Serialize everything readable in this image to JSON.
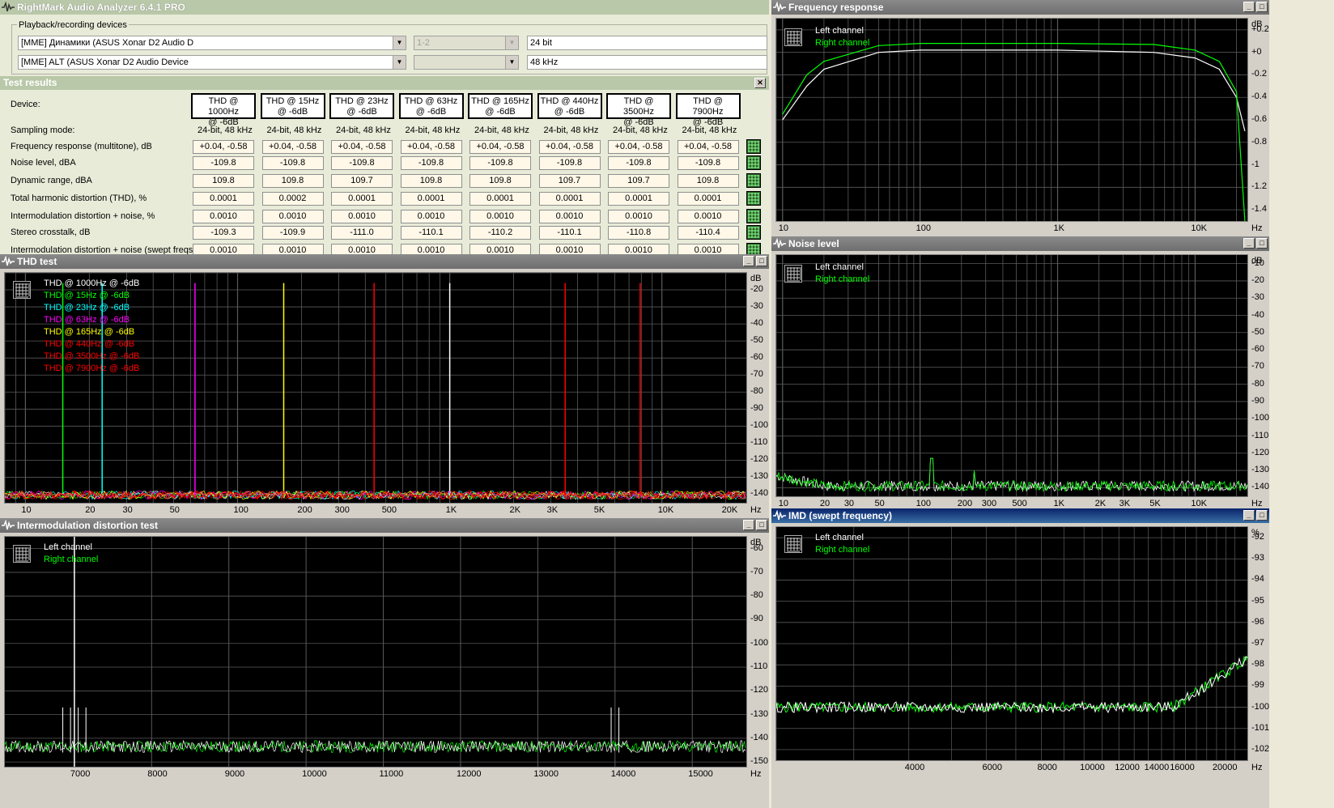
{
  "app": {
    "title": "RightMark Audio Analyzer 6.4.1 PRO",
    "devices_group": "Playback/recording devices",
    "playback_device": "[MME] Динамики (ASUS Xonar D2 Audio D",
    "recording_device": "[MME] ALT (ASUS Xonar D2 Audio Device",
    "channels": "1-2",
    "bits": "24 bit",
    "rate": "48 kHz"
  },
  "results": {
    "title": "Test results",
    "close": "✕",
    "row_labels": [
      "Device:",
      "Sampling mode:",
      "Frequency response (multitone), dB",
      "Noise level, dBA",
      "Dynamic range, dBA",
      "Total harmonic distortion (THD), %",
      "Intermodulation distortion + noise, %",
      "Stereo crosstalk, dB",
      "Intermodulation distortion + noise (swept freqs), %"
    ],
    "columns": [
      {
        "head1": "THD @ 1000Hz",
        "head2": "@ -6dB",
        "mode": "24-bit, 48 kHz",
        "fr": "+0.04, -0.58",
        "noise": "-109.8",
        "dr": "109.8",
        "thd": "0.0001",
        "imd": "0.0010",
        "xtalk": "-109.3",
        "imds": "0.0010"
      },
      {
        "head1": "THD @ 15Hz",
        "head2": "@ -6dB",
        "mode": "24-bit, 48 kHz",
        "fr": "+0.04, -0.58",
        "noise": "-109.8",
        "dr": "109.8",
        "thd": "0.0002",
        "imd": "0.0010",
        "xtalk": "-109.9",
        "imds": "0.0010"
      },
      {
        "head1": "THD @ 23Hz",
        "head2": "@ -6dB",
        "mode": "24-bit, 48 kHz",
        "fr": "+0.04, -0.58",
        "noise": "-109.8",
        "dr": "109.7",
        "thd": "0.0001",
        "imd": "0.0010",
        "xtalk": "-111.0",
        "imds": "0.0010"
      },
      {
        "head1": "THD @ 63Hz",
        "head2": "@ -6dB",
        "mode": "24-bit, 48 kHz",
        "fr": "+0.04, -0.58",
        "noise": "-109.8",
        "dr": "109.8",
        "thd": "0.0001",
        "imd": "0.0010",
        "xtalk": "-110.1",
        "imds": "0.0010"
      },
      {
        "head1": "THD @ 165Hz",
        "head2": "@ -6dB",
        "mode": "24-bit, 48 kHz",
        "fr": "+0.04, -0.58",
        "noise": "-109.8",
        "dr": "109.8",
        "thd": "0.0001",
        "imd": "0.0010",
        "xtalk": "-110.2",
        "imds": "0.0010"
      },
      {
        "head1": "THD @ 440Hz",
        "head2": "@ -6dB",
        "mode": "24-bit, 48 kHz",
        "fr": "+0.04, -0.58",
        "noise": "-109.8",
        "dr": "109.7",
        "thd": "0.0001",
        "imd": "0.0010",
        "xtalk": "-110.1",
        "imds": "0.0010"
      },
      {
        "head1": "THD @ 3500Hz",
        "head2": "@ -6dB",
        "mode": "24-bit, 48 kHz",
        "fr": "+0.04, -0.58",
        "noise": "-109.8",
        "dr": "109.7",
        "thd": "0.0001",
        "imd": "0.0010",
        "xtalk": "-110.8",
        "imds": "0.0010"
      },
      {
        "head1": "THD @ 7900Hz",
        "head2": "@ -6dB",
        "mode": "24-bit, 48 kHz",
        "fr": "+0.04, -0.58",
        "noise": "-109.8",
        "dr": "109.8",
        "thd": "0.0001",
        "imd": "0.0010",
        "xtalk": "-110.4",
        "imds": "0.0010"
      }
    ]
  },
  "panels": {
    "freq": {
      "title": "Frequency response",
      "legend": [
        "Left channel",
        "Right channel"
      ],
      "unit_y": "dB",
      "unit_x": "Hz"
    },
    "noise": {
      "title": "Noise level",
      "legend": [
        "Left channel",
        "Right channel"
      ],
      "unit_y": "dB",
      "unit_x": "Hz"
    },
    "thd": {
      "title": "THD test",
      "legend": [
        "THD @ 1000Hz  @ -6dB",
        "THD @ 15Hz  @ -6dB",
        "THD @ 23Hz  @ -6dB",
        "THD @ 63Hz  @ -6dB",
        "THD @ 165Hz  @ -6dB",
        "THD @ 440Hz  @ -6dB",
        "THD @ 3500Hz  @ -6dB",
        "THD @ 7900Hz  @ -6dB"
      ],
      "unit_y": "dB",
      "unit_x": "Hz"
    },
    "imd": {
      "title": "Intermodulation distortion test",
      "legend": [
        "Left channel",
        "Right channel"
      ],
      "unit_y": "dB",
      "unit_x": "Hz"
    },
    "imds": {
      "title": "IMD (swept frequency)",
      "legend": [
        "Left channel",
        "Right channel"
      ],
      "unit_y": "%",
      "unit_x": "Hz"
    }
  },
  "colors": {
    "left": "#ffffff",
    "right": "#00ff00",
    "thd": [
      "#ffffff",
      "#00ff00",
      "#00ffff",
      "#ff00ff",
      "#ffff00",
      "#ff0000",
      "#ff0000",
      "#ff0000"
    ]
  },
  "chart_data": [
    {
      "type": "line",
      "id": "freq",
      "x_ticks": [
        "10",
        "100",
        "1K",
        "10K"
      ],
      "y_ticks": [
        "+0.2",
        "+0",
        "-0.2",
        "-0.4",
        "-0.6",
        "-0.8",
        "-1",
        "-1.2",
        "-1.4"
      ],
      "ylim": [
        -1.5,
        0.3
      ],
      "series": [
        {
          "name": "Left channel",
          "x": [
            10,
            15,
            20,
            50,
            100,
            1000,
            5000,
            10000,
            15000,
            20000,
            23000
          ],
          "y": [
            -0.6,
            -0.3,
            -0.15,
            0.0,
            0.02,
            0.02,
            0.0,
            -0.05,
            -0.15,
            -0.4,
            -0.7
          ]
        },
        {
          "name": "Right channel",
          "x": [
            10,
            15,
            20,
            50,
            100,
            1000,
            5000,
            10000,
            15000,
            20000,
            23000
          ],
          "y": [
            -0.55,
            -0.2,
            -0.08,
            0.06,
            0.08,
            0.08,
            0.07,
            0.02,
            -0.08,
            -0.35,
            -1.5
          ]
        }
      ]
    },
    {
      "type": "line",
      "id": "noise",
      "x_ticks": [
        "10",
        "20",
        "30",
        "50",
        "100",
        "200",
        "300",
        "500",
        "1K",
        "2K",
        "3K",
        "5K",
        "10K"
      ],
      "y_ticks": [
        "-10",
        "-20",
        "-30",
        "-40",
        "-50",
        "-60",
        "-70",
        "-80",
        "-90",
        "-100",
        "-110",
        "-120",
        "-130",
        "-140"
      ],
      "ylim": [
        -145,
        -5
      ]
    },
    {
      "type": "line",
      "id": "thd",
      "x_ticks": [
        "10",
        "20",
        "30",
        "50",
        "100",
        "200",
        "300",
        "500",
        "1K",
        "2K",
        "3K",
        "5K",
        "10K",
        "20K"
      ],
      "y_ticks": [
        "-20",
        "-30",
        "-40",
        "-50",
        "-60",
        "-70",
        "-80",
        "-90",
        "-100",
        "-110",
        "-120",
        "-130",
        "-140"
      ],
      "ylim": [
        -145,
        -10
      ],
      "peaks_hz": [
        1000,
        15,
        23,
        63,
        165,
        440,
        3500,
        7900
      ]
    },
    {
      "type": "line",
      "id": "imd",
      "x_ticks": [
        "7000",
        "8000",
        "9000",
        "10000",
        "11000",
        "12000",
        "13000",
        "14000",
        "15000"
      ],
      "y_ticks": [
        "-60",
        "-70",
        "-80",
        "-90",
        "-100",
        "-110",
        "-120",
        "-130",
        "-140",
        "-150"
      ],
      "ylim": [
        -152,
        -55
      ]
    },
    {
      "type": "line",
      "id": "imds",
      "x_ticks": [
        "4000",
        "6000",
        "8000",
        "10000",
        "12000",
        "14000",
        "16000",
        "20000"
      ],
      "y_ticks": [
        "-92",
        "-93",
        "-94",
        "-95",
        "-96",
        "-97",
        "-98",
        "-99",
        "-100",
        "-101",
        "-102"
      ],
      "ylim": [
        -102.5,
        -91.5
      ]
    }
  ]
}
